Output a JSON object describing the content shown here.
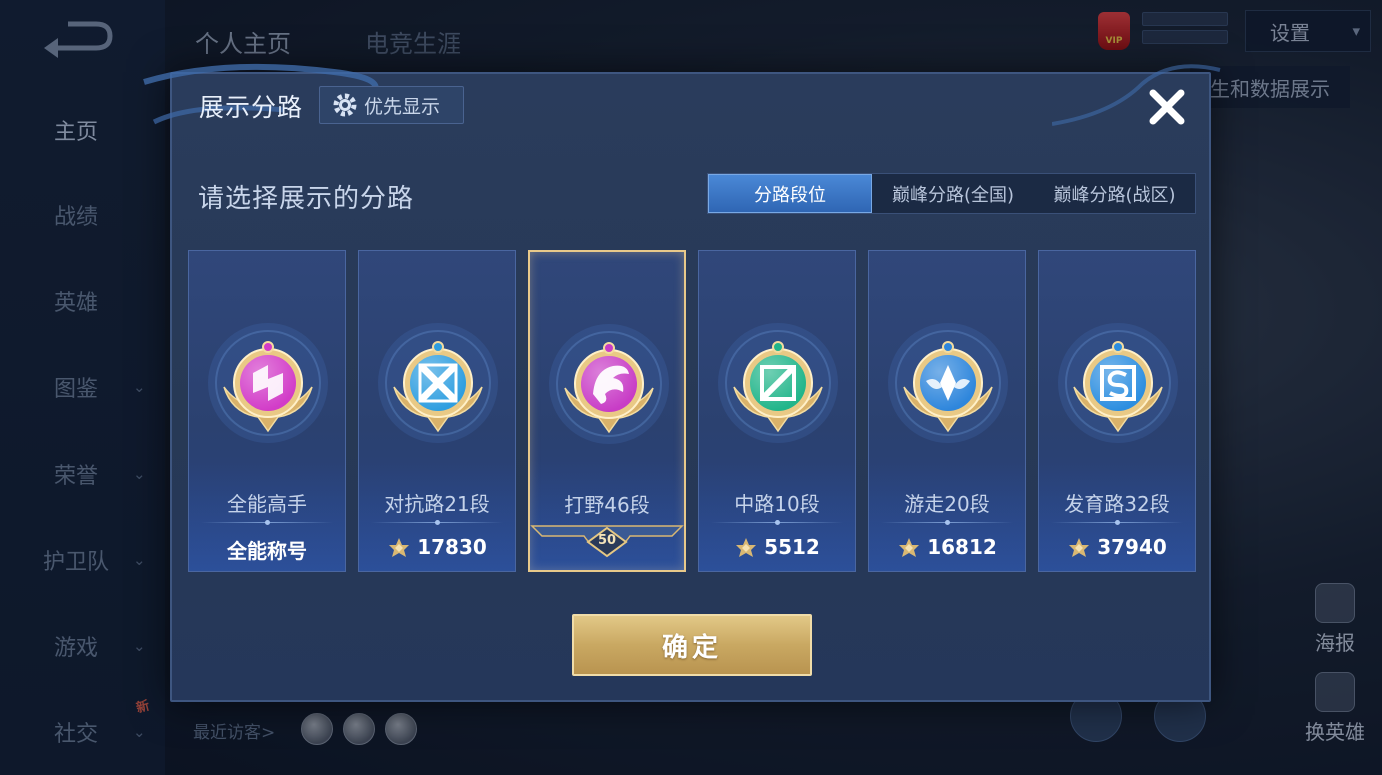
{
  "sidebar": {
    "items": [
      {
        "label": "主页",
        "active": true,
        "chevron": false
      },
      {
        "label": "战绩",
        "active": false,
        "chevron": false
      },
      {
        "label": "英雄",
        "active": false,
        "chevron": false
      },
      {
        "label": "图鉴",
        "active": false,
        "chevron": true
      },
      {
        "label": "荣誉",
        "active": false,
        "chevron": true
      },
      {
        "label": "护卫队",
        "active": false,
        "chevron": true
      },
      {
        "label": "游戏",
        "active": false,
        "chevron": true
      },
      {
        "label": "社交",
        "active": false,
        "chevron": true
      }
    ],
    "new_badge": "新"
  },
  "header": {
    "tabs": [
      "个人主页",
      "电竞生涯"
    ],
    "settings_label": "设置",
    "data_show_label": "生和数据展示",
    "vip_label": "VIP"
  },
  "right_buttons": [
    {
      "label": "海报"
    },
    {
      "label": "换英雄"
    }
  ],
  "footer": {
    "recent_visitors_label": "最近访客>"
  },
  "modal": {
    "title": "展示分路",
    "priority_button": "优先显示",
    "subtitle": "请选择展示的分路",
    "tabs": [
      {
        "label": "分路段位",
        "active": true
      },
      {
        "label": "巅峰分路(全国)",
        "active": false
      },
      {
        "label": "巅峰分路(战区)",
        "active": false
      }
    ],
    "cards": [
      {
        "name": "全能高手",
        "value": "全能称号",
        "value_icon": false,
        "emblem": "all-round-emblem",
        "color": "#d23cc8",
        "selected": false
      },
      {
        "name": "对抗路21段",
        "value": "17830",
        "value_icon": true,
        "emblem": "clash-lane-emblem",
        "color": "#2e9ee0",
        "selected": false
      },
      {
        "name": "打野46段",
        "value": "",
        "value_icon": false,
        "emblem": "jungle-emblem",
        "color": "#c83cc6",
        "selected": true,
        "level": "50"
      },
      {
        "name": "中路10段",
        "value": "5512",
        "value_icon": true,
        "emblem": "mid-lane-emblem",
        "color": "#21b58a",
        "selected": false
      },
      {
        "name": "游走20段",
        "value": "16812",
        "value_icon": true,
        "emblem": "roam-emblem",
        "color": "#2e86dc",
        "selected": false
      },
      {
        "name": "发育路32段",
        "value": "37940",
        "value_icon": true,
        "emblem": "farm-lane-emblem",
        "color": "#2c8ee0",
        "selected": false
      }
    ],
    "confirm_label": "确定"
  },
  "colors": {
    "gold": "#e3c27a",
    "accent_blue": "#3f7ccc",
    "modal_bg": "#283a5a"
  }
}
